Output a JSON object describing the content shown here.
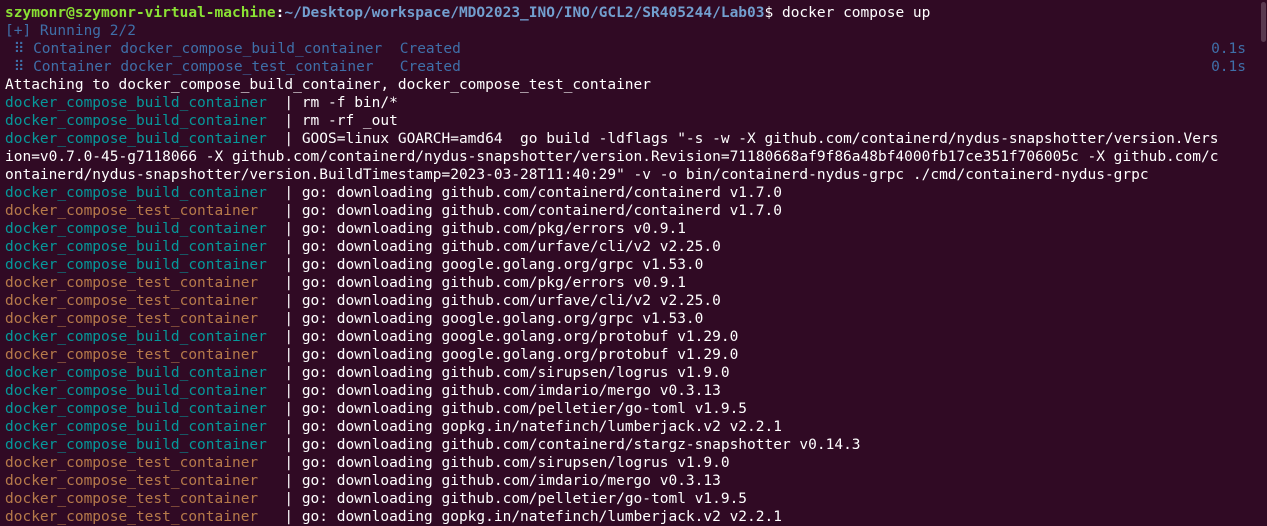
{
  "terminal": {
    "prompt": {
      "user_host": "szymonr@szymonr-virtual-machine",
      "separator": ":",
      "path": "~/Desktop/workspace/MDO2023_INO/INO/GCL2/SR405244/Lab03",
      "dollar": "$ ",
      "command": "docker compose up"
    },
    "status": {
      "running": "[+] Running 2/2",
      "items": [
        {
          "text": " ⠿ Container docker_compose_build_container  Created",
          "time": "0.1s"
        },
        {
          "text": " ⠿ Container docker_compose_test_container   Created",
          "time": "0.1s"
        }
      ]
    },
    "attaching": "Attaching to docker_compose_build_container, docker_compose_test_container",
    "logs": [
      {
        "container": "docker_compose_build_container  ",
        "kind": "build",
        "message": "| rm -f bin/*"
      },
      {
        "container": "docker_compose_build_container  ",
        "kind": "build",
        "message": "| rm -rf _out"
      },
      {
        "container": "docker_compose_build_container  ",
        "kind": "build",
        "message": "| GOOS=linux GOARCH=amd64  go build -ldflags \"-s -w -X github.com/containerd/nydus-snapshotter/version.Vers"
      },
      {
        "container": "",
        "kind": "wrap",
        "message": "ion=v0.7.0-45-g7118066 -X github.com/containerd/nydus-snapshotter/version.Revision=71180668af9f86a48bf4000fb17ce351f706005c -X github.com/c"
      },
      {
        "container": "",
        "kind": "wrap",
        "message": "ontainerd/nydus-snapshotter/version.BuildTimestamp=2023-03-28T11:40:29\" -v -o bin/containerd-nydus-grpc ./cmd/containerd-nydus-grpc"
      },
      {
        "container": "docker_compose_build_container  ",
        "kind": "build",
        "message": "| go: downloading github.com/containerd/containerd v1.7.0"
      },
      {
        "container": "docker_compose_test_container   ",
        "kind": "test",
        "message": "| go: downloading github.com/containerd/containerd v1.7.0"
      },
      {
        "container": "docker_compose_build_container  ",
        "kind": "build",
        "message": "| go: downloading github.com/pkg/errors v0.9.1"
      },
      {
        "container": "docker_compose_build_container  ",
        "kind": "build",
        "message": "| go: downloading github.com/urfave/cli/v2 v2.25.0"
      },
      {
        "container": "docker_compose_build_container  ",
        "kind": "build",
        "message": "| go: downloading google.golang.org/grpc v1.53.0"
      },
      {
        "container": "docker_compose_test_container   ",
        "kind": "test",
        "message": "| go: downloading github.com/pkg/errors v0.9.1"
      },
      {
        "container": "docker_compose_test_container   ",
        "kind": "test",
        "message": "| go: downloading github.com/urfave/cli/v2 v2.25.0"
      },
      {
        "container": "docker_compose_test_container   ",
        "kind": "test",
        "message": "| go: downloading google.golang.org/grpc v1.53.0"
      },
      {
        "container": "docker_compose_build_container  ",
        "kind": "build",
        "message": "| go: downloading google.golang.org/protobuf v1.29.0"
      },
      {
        "container": "docker_compose_test_container   ",
        "kind": "test",
        "message": "| go: downloading google.golang.org/protobuf v1.29.0"
      },
      {
        "container": "docker_compose_build_container  ",
        "kind": "build",
        "message": "| go: downloading github.com/sirupsen/logrus v1.9.0"
      },
      {
        "container": "docker_compose_build_container  ",
        "kind": "build",
        "message": "| go: downloading github.com/imdario/mergo v0.3.13"
      },
      {
        "container": "docker_compose_build_container  ",
        "kind": "build",
        "message": "| go: downloading github.com/pelletier/go-toml v1.9.5"
      },
      {
        "container": "docker_compose_build_container  ",
        "kind": "build",
        "message": "| go: downloading gopkg.in/natefinch/lumberjack.v2 v2.2.1"
      },
      {
        "container": "docker_compose_build_container  ",
        "kind": "build",
        "message": "| go: downloading github.com/containerd/stargz-snapshotter v0.14.3"
      },
      {
        "container": "docker_compose_test_container   ",
        "kind": "test",
        "message": "| go: downloading github.com/sirupsen/logrus v1.9.0"
      },
      {
        "container": "docker_compose_test_container   ",
        "kind": "test",
        "message": "| go: downloading github.com/imdario/mergo v0.3.13"
      },
      {
        "container": "docker_compose_test_container   ",
        "kind": "test",
        "message": "| go: downloading github.com/pelletier/go-toml v1.9.5"
      },
      {
        "container": "docker_compose_test_container   ",
        "kind": "test",
        "message": "| go: downloading gopkg.in/natefinch/lumberjack.v2 v2.2.1"
      }
    ]
  },
  "colors": {
    "background": "#300a24",
    "prompt_user": "#8ae234",
    "prompt_path": "#729fcf",
    "build_container": "#06989a",
    "test_container": "#b67a4a",
    "status_faint": "#3f6fa8",
    "text": "#ffffff"
  }
}
